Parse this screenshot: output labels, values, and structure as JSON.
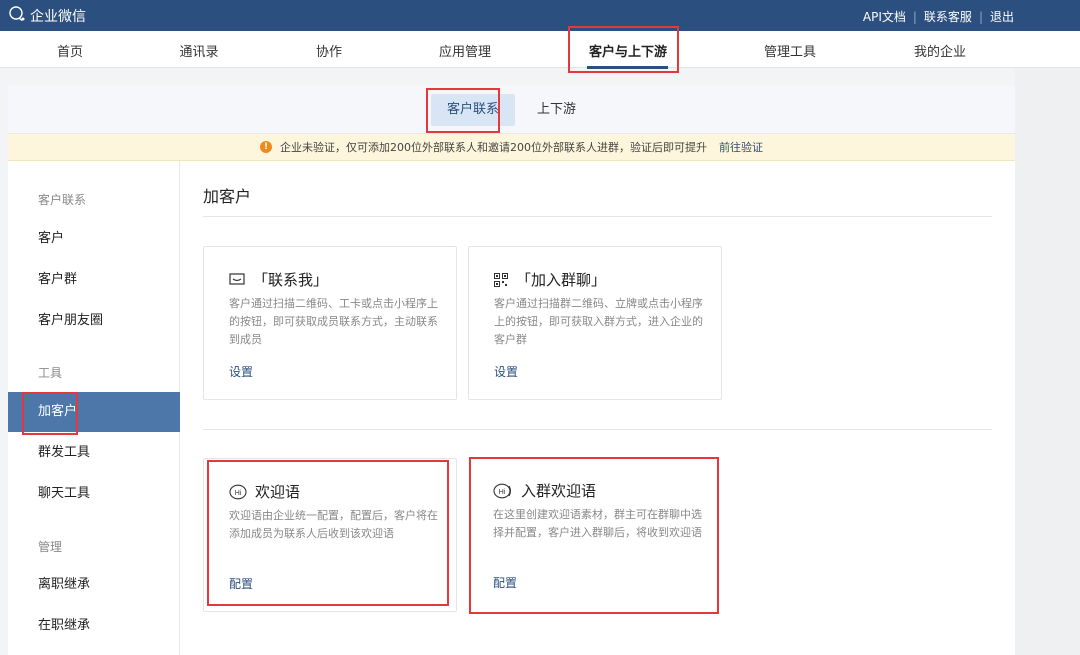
{
  "topbar": {
    "brand": "企业微信",
    "links": [
      "API文档",
      "联系客服",
      "退出"
    ],
    "separator": "|"
  },
  "main_nav": {
    "items": [
      "首页",
      "通讯录",
      "协作",
      "应用管理",
      "客户与上下游",
      "管理工具",
      "我的企业"
    ],
    "active": "客户与上下游"
  },
  "sub_nav": {
    "tabs": [
      "客户联系",
      "上下游"
    ],
    "active": "客户联系"
  },
  "notice": {
    "icon": "warning-icon",
    "text": "企业未验证，仅可添加200位外部联系人和邀请200位外部联系人进群，验证后即可提升",
    "link": "前往验证"
  },
  "sidebar": {
    "groups": [
      {
        "label": "客户联系",
        "items": [
          "客户",
          "客户群",
          "客户朋友圈"
        ]
      },
      {
        "label": "工具",
        "items": [
          "加客户",
          "群发工具",
          "聊天工具"
        ]
      },
      {
        "label": "管理",
        "items": [
          "离职继承",
          "在职继承"
        ]
      }
    ],
    "active": "加客户"
  },
  "content": {
    "title": "加客户",
    "cards": [
      {
        "icon": "contact-me-icon",
        "title": "「联系我」",
        "desc": "客户通过扫描二维码、工卡或点击小程序上的按钮，即可获取成员联系方式，主动联系到成员",
        "link": "设置"
      },
      {
        "icon": "qrcode-icon",
        "title": "「加入群聊」",
        "desc": "客户通过扫描群二维码、立牌或点击小程序上的按钮，即可获取入群方式，进入企业的客户群",
        "link": "设置"
      },
      {
        "icon": "hi-bubble-icon",
        "title": "欢迎语",
        "desc": "欢迎语由企业统一配置，配置后，客户将在添加成员为联系人后收到该欢迎语",
        "link": "配置"
      },
      {
        "icon": "hi-group-icon",
        "title": "入群欢迎语",
        "desc": "在这里创建欢迎语素材，群主可在群聊中选择并配置，客户进入群聊后，将收到欢迎语",
        "link": "配置"
      }
    ]
  },
  "colors": {
    "brand": "#2b4f7e",
    "active_side": "#4d77a8",
    "highlight_box": "#e5383b",
    "notice_bg": "#fdf6dc"
  }
}
